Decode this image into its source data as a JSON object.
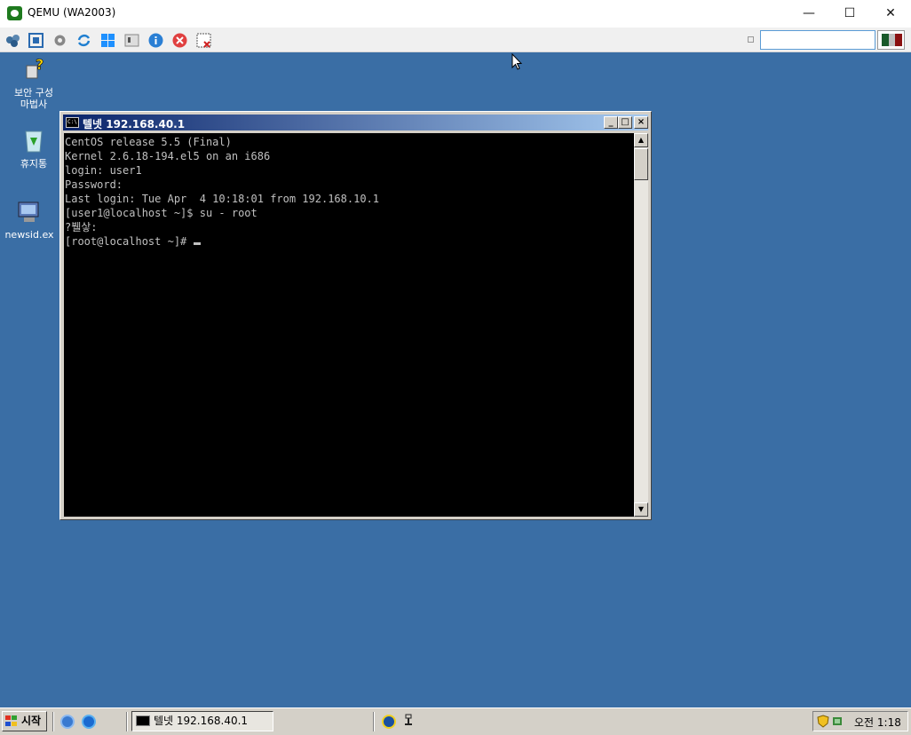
{
  "host_window": {
    "title": "QEMU (WA2003)",
    "controls": {
      "minimize": "—",
      "maximize": "☐",
      "close": "✕"
    }
  },
  "toolbar": {
    "icons": [
      "settings-cube-icon",
      "fullscreen-icon",
      "gear-icon",
      "refresh-icon",
      "windows-icon",
      "disk-icon",
      "info-icon",
      "stop-icon",
      "screenshot-icon"
    ],
    "search_value": "",
    "colors": {
      "accent_border": "#5a9bd5"
    }
  },
  "desktop": {
    "background": "#3a6ea5",
    "icons": [
      {
        "label_line1": "보안 구성",
        "label_line2": "마법사"
      },
      {
        "label_line1": "휴지통",
        "label_line2": ""
      },
      {
        "label_line1": "newsid.ex",
        "label_line2": ""
      }
    ]
  },
  "telnet": {
    "title": "텔넷 192.168.40.1",
    "icon_text": "C:\\",
    "lines": [
      "CentOS release 5.5 (Final)",
      "Kernel 2.6.18-194.el5 on an i686",
      "login: user1",
      "Password:",
      "Last login: Tue Apr  4 10:18:01 from 192.168.10.1",
      "[user1@localhost ~]$ su - root",
      "?뷀샇:",
      "[root@localhost ~]#"
    ]
  },
  "taskbar": {
    "start_label": "시작",
    "task_label": "텔넷 192.168.40.1",
    "clock": "오전 1:18"
  }
}
